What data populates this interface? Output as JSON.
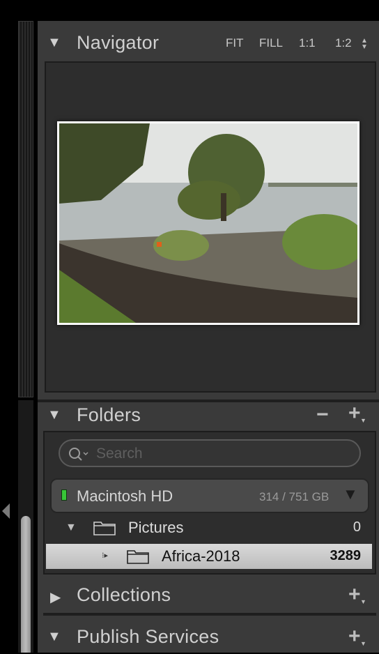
{
  "navigator": {
    "title": "Navigator",
    "zoom_options": [
      "FIT",
      "FILL",
      "1:1",
      "1:2"
    ],
    "preview_icon": "landscape-photo"
  },
  "folders": {
    "title": "Folders",
    "remove_icon": "minus-icon",
    "add_icon": "plus-icon",
    "search_placeholder": "Search",
    "volume": {
      "name": "Macintosh HD",
      "usage": "314 / 751 GB",
      "status_color": "#38c638"
    },
    "items": [
      {
        "name": "Pictures",
        "count": "0"
      },
      {
        "name": "Africa-2018",
        "count": "3289"
      }
    ]
  },
  "collections": {
    "title": "Collections"
  },
  "publish": {
    "title": "Publish Services"
  }
}
